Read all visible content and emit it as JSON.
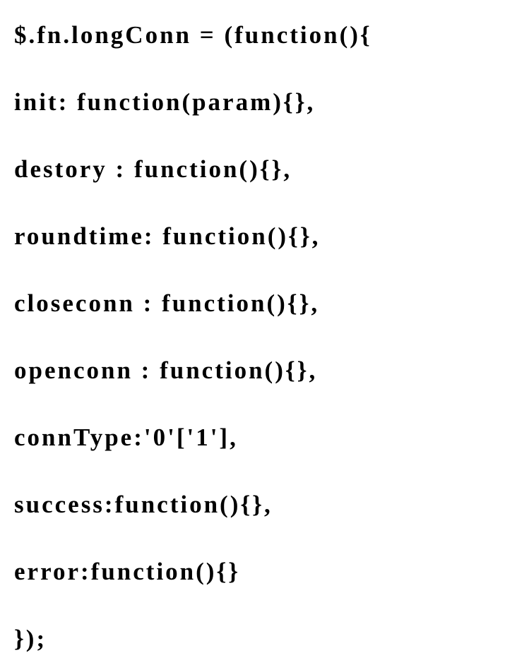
{
  "code": {
    "lines": [
      "$.fn.longConn = (function(){",
      "init: function(param){},",
      "destory : function(){},",
      "roundtime: function(){},",
      "closeconn : function(){},",
      "openconn : function(){},",
      "connType:'0'['1'],",
      "success:function(){},",
      "error:function(){}",
      "});"
    ]
  }
}
